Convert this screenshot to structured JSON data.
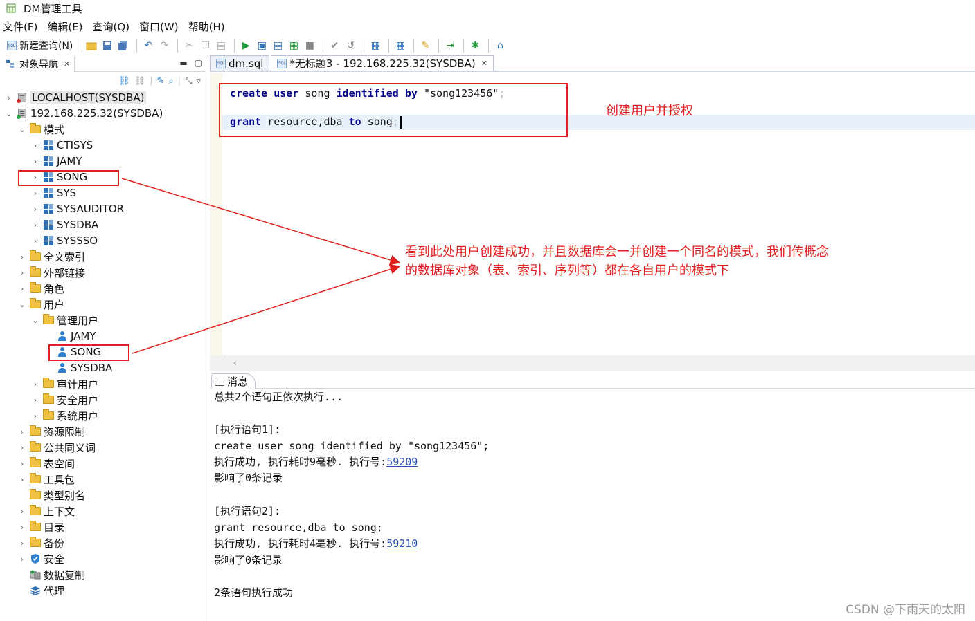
{
  "window": {
    "title": "DM管理工具"
  },
  "menu": [
    "文件(F)",
    "编辑(E)",
    "查询(Q)",
    "窗口(W)",
    "帮助(H)"
  ],
  "toolbar": {
    "new_query_label": "新建查询(N)"
  },
  "navigator": {
    "title": "对象导航",
    "tree": [
      {
        "label": "LOCALHOST(SYSDBA)",
        "icon": "server-icon"
      },
      {
        "label": "192.168.225.32(SYSDBA)",
        "icon": "server-icon"
      },
      {
        "label": "模式",
        "icon": "folder-icon"
      },
      {
        "label": "CTISYS",
        "icon": "schema-icon"
      },
      {
        "label": "JAMY",
        "icon": "schema-icon"
      },
      {
        "label": "SONG",
        "icon": "schema-icon"
      },
      {
        "label": "SYS",
        "icon": "schema-icon"
      },
      {
        "label": "SYSAUDITOR",
        "icon": "schema-icon"
      },
      {
        "label": "SYSDBA",
        "icon": "schema-icon"
      },
      {
        "label": "SYSSSO",
        "icon": "schema-icon"
      },
      {
        "label": "全文索引",
        "icon": "folder-icon"
      },
      {
        "label": "外部链接",
        "icon": "folder-icon"
      },
      {
        "label": "角色",
        "icon": "folder-icon"
      },
      {
        "label": "用户",
        "icon": "folder-icon"
      },
      {
        "label": "管理用户",
        "icon": "folder-icon"
      },
      {
        "label": "JAMY",
        "icon": "user-icon"
      },
      {
        "label": "SONG",
        "icon": "user-icon"
      },
      {
        "label": "SYSDBA",
        "icon": "user-icon"
      },
      {
        "label": "审计用户",
        "icon": "folder-icon"
      },
      {
        "label": "安全用户",
        "icon": "folder-icon"
      },
      {
        "label": "系统用户",
        "icon": "folder-icon"
      },
      {
        "label": "资源限制",
        "icon": "folder-icon"
      },
      {
        "label": "公共同义词",
        "icon": "folder-icon"
      },
      {
        "label": "表空间",
        "icon": "folder-icon"
      },
      {
        "label": "工具包",
        "icon": "folder-icon"
      },
      {
        "label": "类型别名",
        "icon": "folder-icon"
      },
      {
        "label": "上下文",
        "icon": "folder-icon"
      },
      {
        "label": "目录",
        "icon": "folder-icon"
      },
      {
        "label": "备份",
        "icon": "folder-icon"
      },
      {
        "label": "安全",
        "icon": "shield-icon"
      },
      {
        "label": "数据复制",
        "icon": "replication-icon"
      },
      {
        "label": "代理",
        "icon": "layers-icon"
      }
    ]
  },
  "editor": {
    "tabs": [
      "dm.sql",
      "*无标题3 - 192.168.225.32(SYSDBA)"
    ],
    "line1": {
      "kw1": "create",
      "kw2": "user",
      "plain1": " song ",
      "kw3": "identified",
      "kw4": "by",
      "plain2": " \"song123456\"",
      "semi": ";"
    },
    "line2": {
      "kw1": "grant",
      "plain1": " resource,dba ",
      "kw2": "to",
      "plain2": " song",
      "semi": ";"
    }
  },
  "messages": {
    "tab_label": "消息",
    "lines": [
      "总共2个语句正依次执行...",
      "[执行语句1]:",
      "create user song identified by \"song123456\";",
      "执行成功, 执行耗时9毫秒. 执行号:",
      "影响了0条记录",
      "[执行语句2]:",
      "grant resource,dba to song;",
      "执行成功, 执行耗时4毫秒. 执行号:",
      "影响了0条记录",
      "2条语句执行成功"
    ],
    "exec_ids": [
      "59209",
      "59210"
    ]
  },
  "annotations": {
    "create_user_note": "创建用户并授权",
    "schema_note_line1": "看到此处用户创建成功，并且数据库会一并创建一个同名的模式，我们传概念",
    "schema_note_line2": "的数据库对象（表、索引、序列等）都在各自用户的模式下",
    "color": "#e02020"
  },
  "watermark": "CSDN @下雨天的太阳"
}
